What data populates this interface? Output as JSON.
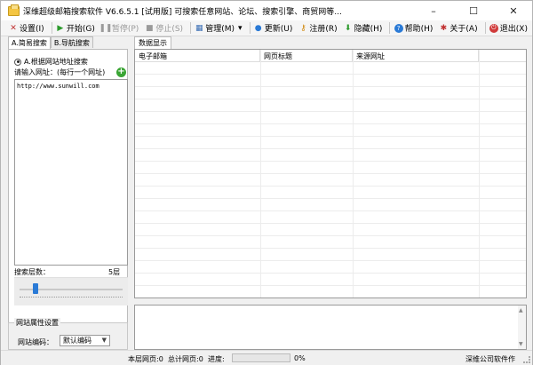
{
  "window": {
    "title": "深维超级邮箱搜索软件 V6.6.5.1 [试用版] 可搜索任意网站、论坛、搜索引擎、商贸网等...",
    "minimize": "–",
    "maximize": "☐",
    "close": "✕"
  },
  "toolbar": {
    "settings": "设置(I)",
    "start": "开始(G)",
    "pause": "暂停(P)",
    "stop": "停止(S)",
    "manage": "管理(M)",
    "update": "更新(U)",
    "register": "注册(R)",
    "hide": "隐藏(H)",
    "help": "帮助(H)",
    "about": "关于(A)",
    "exit": "退出(X)",
    "dropdown": "▾"
  },
  "left_panel": {
    "tabs": [
      "A.简易搜索",
      "B.导航搜索"
    ],
    "radio_label": "A.根据网站地址搜索",
    "url_label": "请输入网址：(每行一个网址)",
    "url_value": "http://www.sunwill.com",
    "depth_label": "搜索层数：",
    "depth_value": "5层",
    "depth_level": 5,
    "group_title": "网站属性设置",
    "encoding_label": "网站编码：",
    "encoding_value": "默认编码"
  },
  "right_panel": {
    "tab": "数据显示",
    "columns": [
      "电子邮箱",
      "网页标题",
      "来源网址"
    ]
  },
  "status": {
    "layer_pages": "本层网页:0",
    "total_pages": "总计网页:0",
    "progress_label": "进度:",
    "progress_value": "0%",
    "progress": 0,
    "company": "深维公司软件作"
  },
  "colors": {
    "slider_thumb": "#2a7ad6",
    "plus_button": "#3aa534"
  }
}
